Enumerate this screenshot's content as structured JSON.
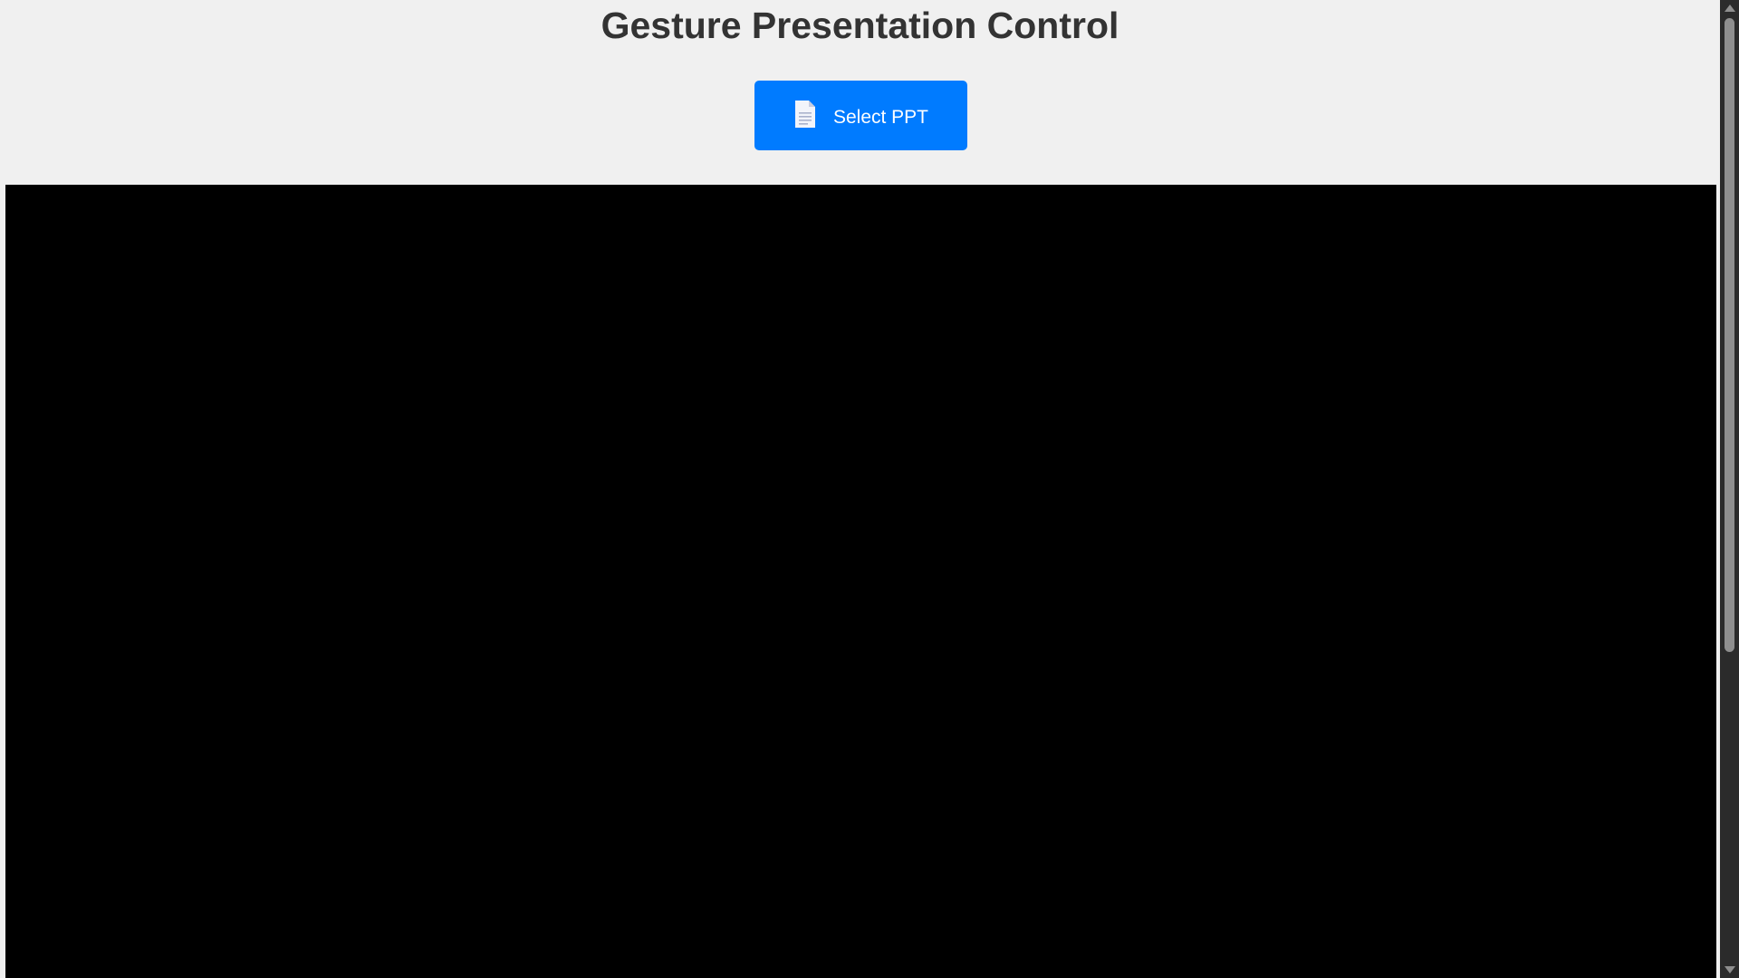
{
  "header": {
    "title": "Gesture Presentation Control"
  },
  "controls": {
    "select_button_label": "Select PPT",
    "select_button_icon": "document-icon"
  },
  "colors": {
    "page_background": "#f0f0f0",
    "title_text": "#333333",
    "button_background": "#007bff",
    "button_text": "#ffffff",
    "stage_background": "#000000",
    "scrollbar_track": "#2b2b2b",
    "scrollbar_thumb": "#8f8f8f"
  }
}
